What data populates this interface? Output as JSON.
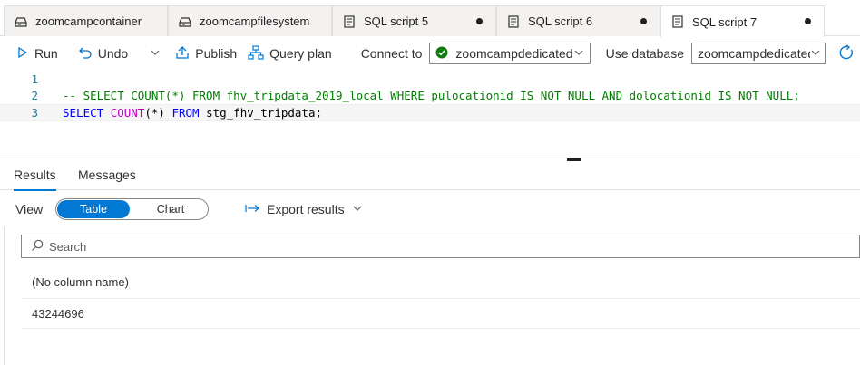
{
  "tabs": [
    {
      "label": "zoomcampcontainer",
      "icon": "storage-container-icon",
      "dirty": false,
      "active": false
    },
    {
      "label": "zoomcampfilesystem",
      "icon": "storage-container-icon",
      "dirty": false,
      "active": false
    },
    {
      "label": "SQL script 5",
      "icon": "sql-script-icon",
      "dirty": true,
      "active": false
    },
    {
      "label": "SQL script 6",
      "icon": "sql-script-icon",
      "dirty": true,
      "active": false
    },
    {
      "label": "SQL script 7",
      "icon": "sql-script-icon",
      "dirty": true,
      "active": true
    }
  ],
  "toolbar": {
    "run_label": "Run",
    "undo_label": "Undo",
    "publish_label": "Publish",
    "query_plan_label": "Query plan",
    "connect_to_label": "Connect to",
    "connect_to_value": "zoomcampdedicated",
    "use_database_label": "Use database",
    "use_database_value": "zoomcampdedicated"
  },
  "editor": {
    "lines": [
      {
        "number": "1",
        "text": ""
      },
      {
        "number": "2",
        "text": "-- SELECT COUNT(*) FROM fhv_tripdata_2019_local WHERE pulocationid IS NOT NULL AND dolocationid IS NOT NULL;"
      },
      {
        "number": "3",
        "select": "SELECT",
        "count": "COUNT",
        "args": "(*)",
        "from": "FROM",
        "table": "stg_fhv_tripdata;"
      }
    ]
  },
  "results": {
    "tab_results": "Results",
    "tab_messages": "Messages",
    "view_label": "View",
    "view_table": "Table",
    "view_chart": "Chart",
    "export_label": "Export results",
    "search_placeholder": "Search",
    "column_header": "(No column name)",
    "rows": [
      "43244696"
    ]
  },
  "colors": {
    "accent": "#0078d4",
    "success": "#107c10"
  }
}
